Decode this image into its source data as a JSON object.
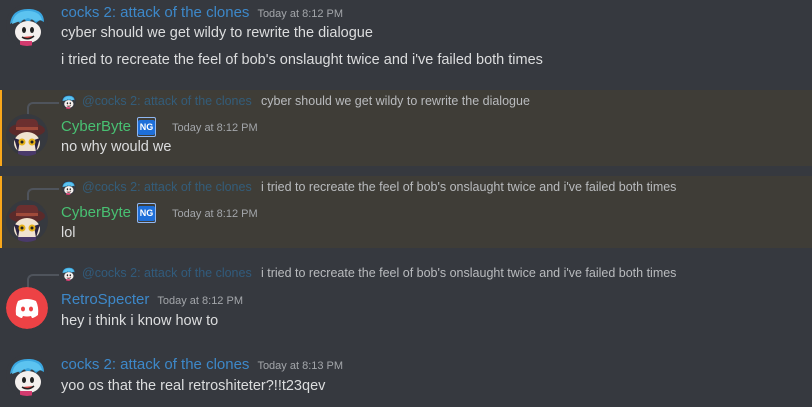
{
  "colors": {
    "background": "#36393f",
    "mention_highlight": "#3f3d37",
    "mention_bar": "#faa81a",
    "name_blue": "#3d88c9",
    "name_green": "#48c072",
    "badge_blue": "#1e6fd9"
  },
  "messages": [
    {
      "author": "cocks 2: attack of the clones",
      "timestamp": "Today at 8:12 PM",
      "avatar": "bf-avatar-icon",
      "lines": [
        "cyber should we get wildy to rewrite the dialogue",
        "i tried to recreate the feel of bob's onslaught twice and i've failed both times"
      ]
    },
    {
      "reply_author": "@cocks 2: attack of the clones",
      "reply_text": "cyber should we get wildy to rewrite the dialogue",
      "author": "CyberByte",
      "badge": "NG",
      "timestamp": "Today at 8:12 PM",
      "avatar": "niko-avatar-icon",
      "text": "no why would we"
    },
    {
      "reply_author": "@cocks 2: attack of the clones",
      "reply_text": "i tried to recreate the feel of bob's onslaught twice and i've failed both times",
      "author": "CyberByte",
      "badge": "NG",
      "timestamp": "Today at 8:12 PM",
      "avatar": "niko-avatar-icon",
      "text": "lol"
    },
    {
      "reply_author": "@cocks 2: attack of the clones",
      "reply_text": "i tried to recreate the feel of bob's onslaught twice and i've failed both times",
      "author": "RetroSpecter",
      "timestamp": "Today at 8:12 PM",
      "avatar": "discord-logo-icon",
      "text": "hey i think i know how to"
    },
    {
      "author": "cocks 2: attack of the clones",
      "timestamp": "Today at 8:13 PM",
      "avatar": "bf-avatar-icon",
      "text": "yoo os that the real retroshiteter?!!t23qev"
    }
  ]
}
